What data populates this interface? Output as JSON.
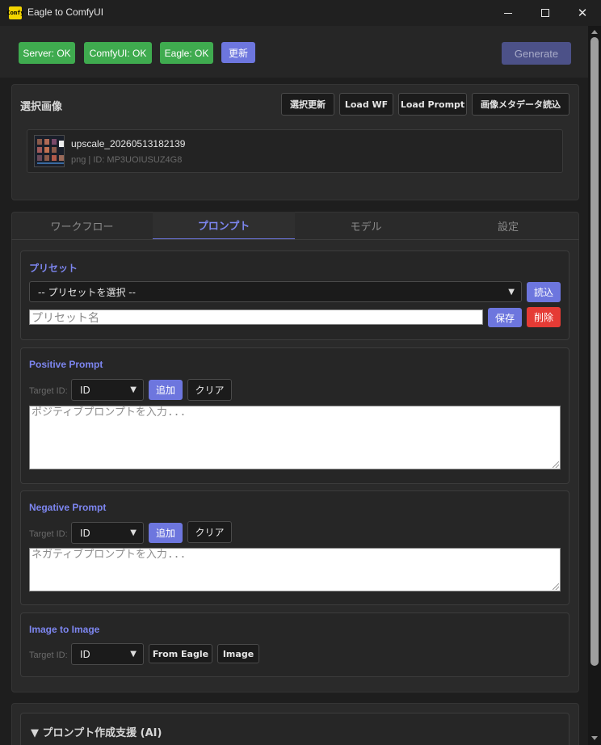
{
  "window": {
    "title": "Eagle to ComfyUI",
    "icon_text": "Comfy"
  },
  "status": {
    "server": "Server: OK",
    "comfyui": "ComfyUI: OK",
    "eagle": "Eagle: OK",
    "refresh": "更新",
    "generate": "Generate"
  },
  "selected": {
    "title": "選択画像",
    "buttons": [
      "選択更新",
      "Load WF",
      "Load Prompt",
      "画像メタデータ読込"
    ],
    "image": {
      "name": "upscale_20260513182139",
      "meta": "png | ID: MP3UOIUSUZ4G8"
    }
  },
  "tabs": [
    "ワークフロー",
    "プロンプト",
    "モデル",
    "設定"
  ],
  "preset": {
    "title": "プリセット",
    "select_value": "-- プリセットを選択 --",
    "load": "読込",
    "name_placeholder": "プリセット名",
    "save": "保存",
    "delete": "削除"
  },
  "positive": {
    "title": "Positive Prompt",
    "target_label": "Target ID:",
    "target_value": "ID",
    "add": "追加",
    "clear": "クリア",
    "placeholder": "ポジティブプロンプトを入力..."
  },
  "negative": {
    "title": "Negative Prompt",
    "target_label": "Target ID:",
    "target_value": "ID",
    "add": "追加",
    "clear": "クリア",
    "placeholder": "ネガティブプロンプトを入力..."
  },
  "i2i": {
    "title": "Image to Image",
    "target_label": "Target ID:",
    "target_value": "ID",
    "from_eagle": "From Eagle",
    "image": "Image"
  },
  "ai": {
    "title": "▼ プロンプト作成支援 (AI)"
  },
  "colors": {
    "ok": "#3fab4f",
    "accent": "#6d76de",
    "danger": "#e53b35",
    "bg": "#1e1e1e"
  }
}
